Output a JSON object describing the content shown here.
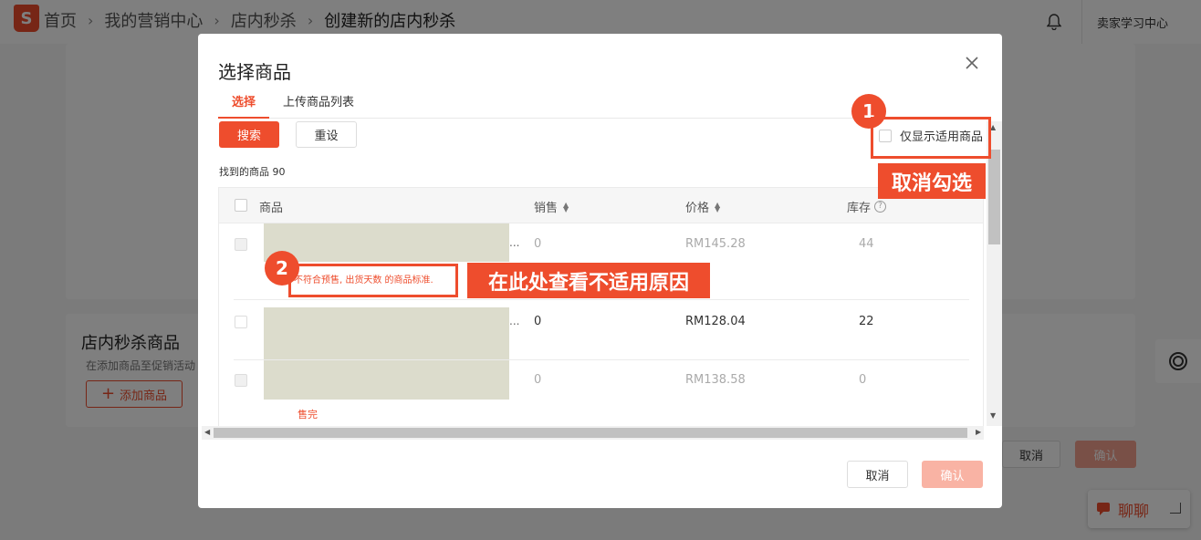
{
  "breadcrumb": {
    "home": "首页",
    "marketing": "我的营销中心",
    "flash_sale": "店内秒杀",
    "current": "创建新的店内秒杀"
  },
  "header": {
    "seller_learning": "卖家学习中心",
    "logo_letter": "S"
  },
  "section": {
    "title": "店内秒杀商品",
    "desc": "在添加商品至促销活动",
    "add_button": "添加商品",
    "cancel": "取消",
    "confirm": "确认"
  },
  "chat": {
    "label": "聊聊"
  },
  "modal": {
    "title": "选择商品",
    "tabs": [
      "选择",
      "上传商品列表"
    ],
    "search_button": "搜索",
    "reset_button": "重设",
    "found_text": "找到的商品 90",
    "only_applicable": "仅显示适用商品",
    "columns": {
      "product": "商品",
      "sales": "销售",
      "price": "价格",
      "stock": "库存"
    },
    "rows": [
      {
        "sales": "0",
        "price": "RM145.28",
        "stock": "44",
        "note": "不符合预售, 出货天数 的商品标准.",
        "disabled": true
      },
      {
        "sales": "0",
        "price": "RM128.04",
        "stock": "22",
        "note": "",
        "disabled": false
      },
      {
        "sales": "0",
        "price": "RM138.58",
        "stock": "0",
        "note": "售完",
        "disabled": true
      }
    ],
    "ellipsis": "...",
    "cancel": "取消",
    "confirm": "确认"
  },
  "annotations": {
    "step1": "1",
    "step1_text": "取消勾选",
    "step2": "2",
    "step2_text": "在此处查看不适用原因"
  },
  "colors": {
    "accent": "#ee4d2d",
    "confirm_disabled": "#f9b3a4"
  }
}
